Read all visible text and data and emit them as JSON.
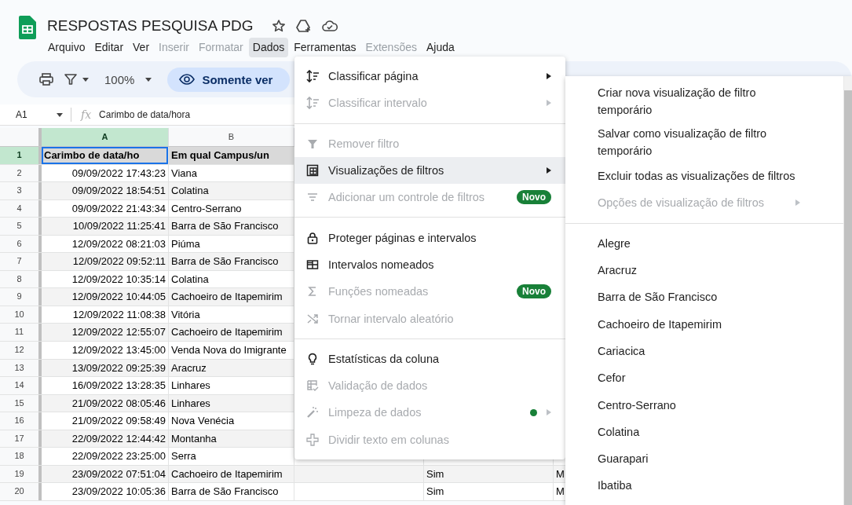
{
  "document": {
    "title": "RESPOSTAS PESQUISA PDG"
  },
  "menu_bar": [
    {
      "label": "Arquivo",
      "disabled": false,
      "selected": false
    },
    {
      "label": "Editar",
      "disabled": false,
      "selected": false
    },
    {
      "label": "Ver",
      "disabled": false,
      "selected": false
    },
    {
      "label": "Inserir",
      "disabled": true,
      "selected": false
    },
    {
      "label": "Formatar",
      "disabled": true,
      "selected": false
    },
    {
      "label": "Dados",
      "disabled": false,
      "selected": true
    },
    {
      "label": "Ferramentas",
      "disabled": false,
      "selected": false
    },
    {
      "label": "Extensões",
      "disabled": true,
      "selected": false
    },
    {
      "label": "Ajuda",
      "disabled": false,
      "selected": false
    }
  ],
  "toolbar": {
    "zoom": "100%",
    "view_mode": "Somente ver"
  },
  "formula_bar": {
    "cell_ref": "A1",
    "function_label": "fx",
    "content": "Carimbo de data/hora"
  },
  "sheet": {
    "columns": [
      {
        "label": "A",
        "selected": true
      },
      {
        "label": "B",
        "selected": false
      }
    ],
    "rows": [
      {
        "number": "1",
        "kind": "header",
        "selected": true,
        "cells": {
          "A": "Carimbo de data/ho",
          "B": "Em qual Campus/un"
        }
      },
      {
        "number": "2",
        "kind": "data",
        "selected": false,
        "cells": {
          "A": "09/09/2022 17:43:23",
          "B": "Viana"
        }
      },
      {
        "number": "3",
        "kind": "data",
        "selected": false,
        "cells": {
          "A": "09/09/2022 18:54:51",
          "B": "Colatina"
        }
      },
      {
        "number": "4",
        "kind": "data",
        "selected": false,
        "cells": {
          "A": "09/09/2022 21:43:34",
          "B": "Centro-Serrano"
        }
      },
      {
        "number": "5",
        "kind": "data",
        "selected": false,
        "cells": {
          "A": "10/09/2022 11:25:41",
          "B": "Barra de São Francisco"
        }
      },
      {
        "number": "6",
        "kind": "data",
        "selected": false,
        "cells": {
          "A": "12/09/2022 08:21:03",
          "B": "Piúma"
        }
      },
      {
        "number": "7",
        "kind": "data",
        "selected": false,
        "cells": {
          "A": "12/09/2022 09:52:11",
          "B": "Barra de São Francisco"
        }
      },
      {
        "number": "8",
        "kind": "data",
        "selected": false,
        "cells": {
          "A": "12/09/2022 10:35:14",
          "B": "Colatina"
        }
      },
      {
        "number": "9",
        "kind": "data",
        "selected": false,
        "cells": {
          "A": "12/09/2022 10:44:05",
          "B": "Cachoeiro de Itapemirim"
        }
      },
      {
        "number": "10",
        "kind": "data",
        "selected": false,
        "cells": {
          "A": "12/09/2022 11:08:38",
          "B": "Vitória"
        }
      },
      {
        "number": "11",
        "kind": "data",
        "selected": false,
        "cells": {
          "A": "12/09/2022 12:55:07",
          "B": "Cachoeiro de Itapemirim"
        }
      },
      {
        "number": "12",
        "kind": "data",
        "selected": false,
        "cells": {
          "A": "12/09/2022 13:45:00",
          "B": "Venda Nova do Imigrante"
        }
      },
      {
        "number": "13",
        "kind": "data",
        "selected": false,
        "cells": {
          "A": "13/09/2022 09:25:39",
          "B": "Aracruz"
        }
      },
      {
        "number": "14",
        "kind": "data",
        "selected": false,
        "cells": {
          "A": "16/09/2022 13:28:35",
          "B": "Linhares"
        }
      },
      {
        "number": "15",
        "kind": "data",
        "selected": false,
        "cells": {
          "A": "21/09/2022 08:05:46",
          "B": "Linhares"
        }
      },
      {
        "number": "16",
        "kind": "data",
        "selected": false,
        "cells": {
          "A": "21/09/2022 09:58:49",
          "B": "Nova Venécia"
        }
      },
      {
        "number": "17",
        "kind": "data",
        "selected": false,
        "cells": {
          "A": "22/09/2022 12:44:42",
          "B": "Montanha"
        }
      },
      {
        "number": "18",
        "kind": "data",
        "selected": false,
        "cells": {
          "A": "22/09/2022 23:25:00",
          "B": "Serra"
        }
      },
      {
        "number": "19",
        "kind": "data",
        "selected": false,
        "cells": {
          "A": "23/09/2022 07:51:04",
          "B": "Cachoeiro de Itapemirim",
          "D": "Sim",
          "E": "M"
        }
      },
      {
        "number": "20",
        "kind": "data",
        "selected": false,
        "cells": {
          "A": "23/09/2022 10:05:36",
          "B": "Barra de São Francisco",
          "D": "Sim",
          "E": "M"
        }
      }
    ]
  },
  "data_menu": {
    "groups": [
      {
        "items": [
          {
            "label": "Classificar página",
            "disabled": false,
            "selected": false,
            "submenu": true
          },
          {
            "label": "Classificar intervalo",
            "disabled": true,
            "selected": false,
            "submenu": true
          }
        ]
      },
      {
        "items": [
          {
            "label": "Remover filtro",
            "disabled": true,
            "selected": false,
            "submenu": false
          },
          {
            "label": "Visualizações de filtros",
            "disabled": false,
            "selected": true,
            "submenu": true
          },
          {
            "label": "Adicionar um controle de filtros",
            "disabled": true,
            "selected": false,
            "submenu": false,
            "badge": "Novo"
          }
        ]
      },
      {
        "items": [
          {
            "label": "Proteger páginas e intervalos",
            "disabled": false,
            "selected": false,
            "submenu": false
          },
          {
            "label": "Intervalos nomeados",
            "disabled": false,
            "selected": false,
            "submenu": false
          },
          {
            "label": "Funções nomeadas",
            "disabled": true,
            "selected": false,
            "submenu": false,
            "badge": "Novo"
          },
          {
            "label": "Tornar intervalo aleatório",
            "disabled": true,
            "selected": false,
            "submenu": false
          }
        ]
      },
      {
        "items": [
          {
            "label": "Estatísticas da coluna",
            "disabled": false,
            "selected": false,
            "submenu": false
          },
          {
            "label": "Validação de dados",
            "disabled": true,
            "selected": false,
            "submenu": false
          },
          {
            "label": "Limpeza de dados",
            "disabled": true,
            "selected": false,
            "submenu": true,
            "dot": true
          },
          {
            "label": "Dividir texto em colunas",
            "disabled": true,
            "selected": false,
            "submenu": false
          }
        ]
      }
    ]
  },
  "filter_views_menu": {
    "groups": [
      {
        "items": [
          {
            "label": "Criar nova visualização de filtro temporário",
            "disabled": false,
            "submenu": false
          },
          {
            "label": "Salvar como visualização de filtro temporário",
            "disabled": false,
            "submenu": false
          },
          {
            "label": "Excluir todas as visualizações de filtros",
            "disabled": false,
            "submenu": false
          },
          {
            "label": "Opções de visualização de filtros",
            "disabled": true,
            "submenu": true
          }
        ]
      },
      {
        "items": [
          {
            "label": "Alegre",
            "disabled": false,
            "submenu": false
          },
          {
            "label": "Aracruz",
            "disabled": false,
            "submenu": false
          },
          {
            "label": "Barra de São Francisco",
            "disabled": false,
            "submenu": false
          },
          {
            "label": "Cachoeiro de Itapemirim",
            "disabled": false,
            "submenu": false
          },
          {
            "label": "Cariacica",
            "disabled": false,
            "submenu": false
          },
          {
            "label": "Cefor",
            "disabled": false,
            "submenu": false
          },
          {
            "label": "Centro-Serrano",
            "disabled": false,
            "submenu": false
          },
          {
            "label": "Colatina",
            "disabled": false,
            "submenu": false
          },
          {
            "label": "Guarapari",
            "disabled": false,
            "submenu": false
          },
          {
            "label": "Ibatiba",
            "disabled": false,
            "submenu": false
          }
        ]
      }
    ]
  }
}
